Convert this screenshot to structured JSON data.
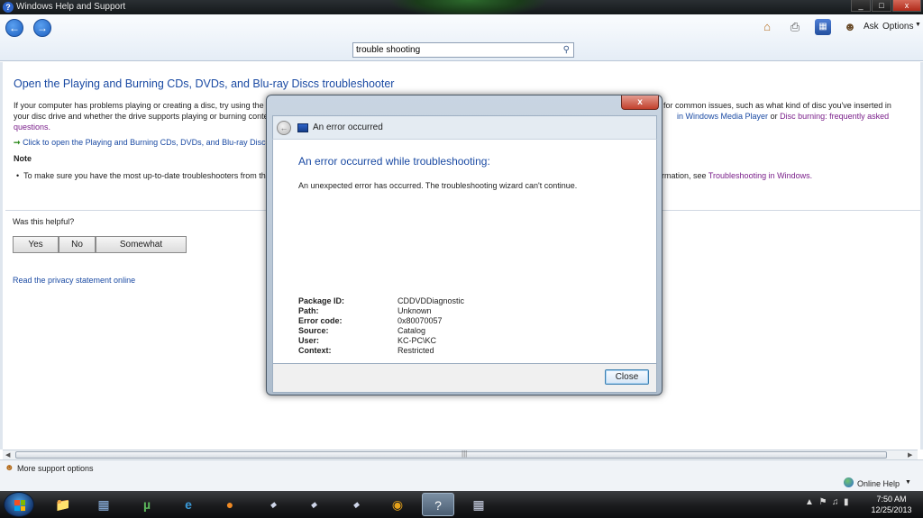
{
  "window": {
    "title": "Windows Help and Support",
    "controls": [
      "_",
      "□",
      "x"
    ]
  },
  "toolbar": {
    "back_icon": "back-arrow-icon",
    "forward_icon": "forward-arrow-icon",
    "search_value": "trouble shooting",
    "ask_label": "Ask",
    "options_label": "Options"
  },
  "content": {
    "heading": "Open the Playing and Burning CDs, DVDs, and Blu-ray Discs troubleshooter",
    "para_line1_start": "If your computer has problems playing or creating a disc, try using the",
    "para_line1_end": "for common issues, such as what kind of disc you've inserted in",
    "para_line2_start": "your disc drive and whether the drive supports playing or burning conte",
    "para_line2_link1": "in Windows Media Player",
    "para_line2_or": "or",
    "para_line2_link2": "Disc burning: frequently asked",
    "para_line3": "questions.",
    "click_link": "Click to open the Playing and Burning CDs, DVDs, and Blu-ray Discs t",
    "note_heading": "Note",
    "note_bullet": "To make sure you have the most up-to-date troubleshooters from th",
    "note_tail_text": "rmation, see",
    "note_tail_link": "Troubleshooting in Windows.",
    "helpful_question": "Was this helpful?",
    "yes_label": "Yes",
    "no_label": "No",
    "somewhat_label": "Somewhat",
    "privacy_link": "Read the privacy statement online"
  },
  "status": {
    "more_support": "More support options",
    "online_help": "Online Help"
  },
  "dialog": {
    "window_title": "An error occurred",
    "heading": "An error occurred while troubleshooting:",
    "message": "An unexpected error has occurred. The troubleshooting wizard can't continue.",
    "details": [
      {
        "key": "Package ID:",
        "value": "CDDVDDiagnostic"
      },
      {
        "key": "Path:",
        "value": "Unknown"
      },
      {
        "key": "Error code:",
        "value": "0x80070057"
      },
      {
        "key": "Source:",
        "value": "Catalog"
      },
      {
        "key": "User:",
        "value": "KC-PC\\KC"
      },
      {
        "key": "Context:",
        "value": "Restricted"
      }
    ],
    "close_label": "Close",
    "close_x": "x"
  },
  "taskbar": {
    "time": "7:50 AM",
    "date": "12/25/2013"
  },
  "colors": {
    "link": "#1a4aa3",
    "visited_link": "#7a1f8a"
  }
}
